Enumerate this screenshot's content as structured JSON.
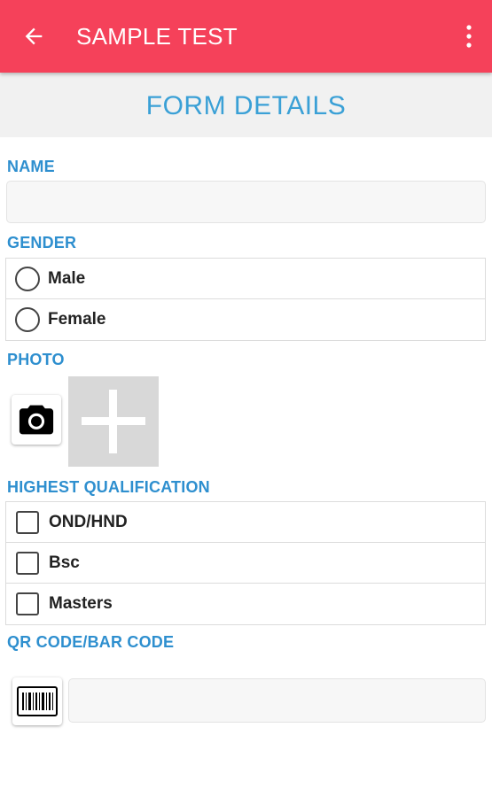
{
  "appbar": {
    "title": "SAMPLE TEST",
    "back_icon": "arrow-back-icon",
    "menu_icon": "more-vert-icon",
    "color": "#f5415a"
  },
  "form": {
    "header": "FORM DETAILS",
    "accent_color": "#2e8fcf",
    "name": {
      "label": "NAME",
      "value": "",
      "placeholder": ""
    },
    "gender": {
      "label": "GENDER",
      "options": [
        {
          "label": "Male",
          "selected": false
        },
        {
          "label": "Female",
          "selected": false
        }
      ]
    },
    "photo": {
      "label": "PHOTO",
      "camera_icon": "camera-icon",
      "placeholder_icon": "plus-icon"
    },
    "qualification": {
      "label": "HIGHEST QUALIFICATION",
      "options": [
        {
          "label": "OND/HND",
          "checked": false
        },
        {
          "label": "Bsc",
          "checked": false
        },
        {
          "label": "Masters",
          "checked": false
        }
      ]
    },
    "code": {
      "label": "QR CODE/BAR CODE",
      "scan_icon": "barcode-icon",
      "value": "",
      "placeholder": ""
    }
  }
}
